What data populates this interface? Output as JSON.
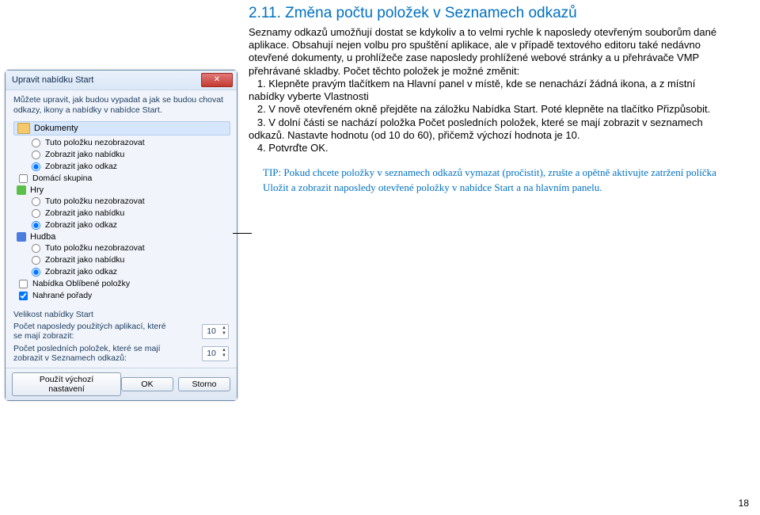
{
  "title": "2.11. Změna počtu položek v Seznamech odkazů",
  "intro": "Seznamy odkazů umožňují dostat se kdykoliv a to velmi rychle k naposledy otevřeným souborům dané aplikace. Obsahují nejen volbu pro spuštění aplikace, ale v případě textového editoru také nedávno otevřené dokumenty, u prohlížeče zase naposledy prohlížené webové stránky a u přehrávače VMP přehrávané skladby. Počet těchto položek je možné změnit:",
  "steps": {
    "s1": "   1. Klepněte pravým tlačítkem na Hlavní panel v místě, kde se nenachází žádná ikona, a z místní nabídky vyberte Vlastnosti",
    "s2": "   2. V nově otevřeném okně přejděte na záložku Nabídka Start. Poté klepněte na tlačítko Přizpůsobit.",
    "s3": "   3. V dolní části se nachází položka Počet posledních položek, které se mají zobrazit v seznamech odkazů. Nastavte hodnotu (od 10 do 60), přičemž výchozí hodnota je 10.",
    "s4": "   4. Potvrďte OK."
  },
  "tip": "TIP: Pokud chcete položky v seznamech odkazů vymazat (pročistit), zrušte a opětně aktivujte zatržení políčka Uložit a zobrazit naposledy otevřené položky v nabídce Start a na hlavním panelu.",
  "page_number": "18",
  "dialog": {
    "title": "Upravit nabídku Start",
    "intro": "Můžete upravit, jak budou vypadat a jak se budou chovat odkazy, ikony a nabídky v nabídce Start.",
    "section_docs": "Dokumenty",
    "option_no_display": "Tuto položku nezobrazovat",
    "option_show_menu": "Zobrazit jako nabídku",
    "option_show_link": "Zobrazit jako odkaz",
    "option_homegroup": "Domácí skupina",
    "section_games": "Hry",
    "section_music": "Hudba",
    "option_fav_menu": "Nabídka Oblíbené položky",
    "option_recorded": "Nahrané pořady",
    "size_label": "Velikost nabídky Start",
    "recent_apps_label": "Počet naposledy použitých aplikací, které se mají zobrazit:",
    "recent_apps_value": "10",
    "recent_items_label": "Počet posledních položek, které se mají zobrazit v Seznamech odkazů:",
    "recent_items_value": "10",
    "btn_defaults": "Použít výchozí nastavení",
    "btn_ok": "OK",
    "btn_cancel": "Storno"
  }
}
